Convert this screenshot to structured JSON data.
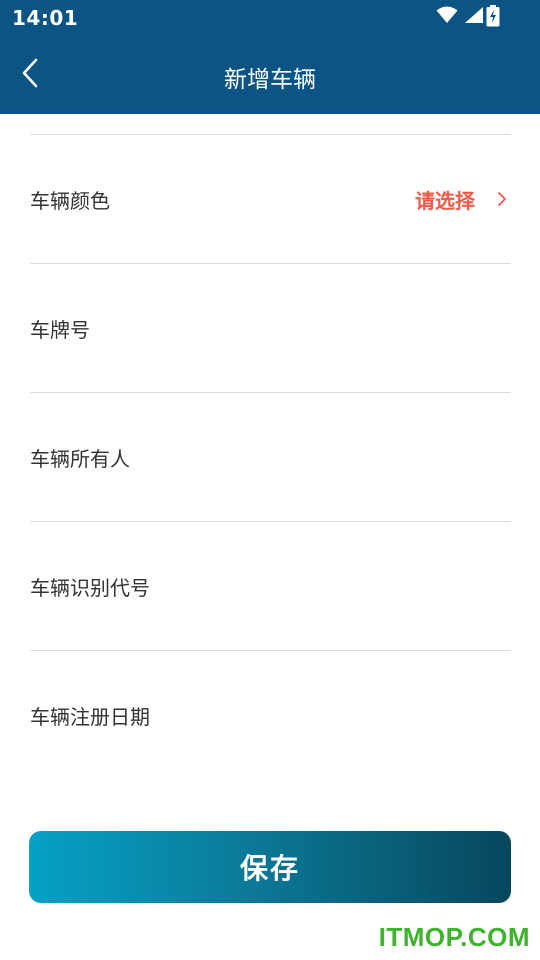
{
  "status_bar": {
    "time": "14:01",
    "icons": [
      "wifi-icon",
      "signal-icon",
      "battery-charging-icon"
    ]
  },
  "nav": {
    "back_icon": "chevron-left-icon",
    "title": "新增车辆"
  },
  "form": {
    "rows": [
      {
        "label": "车辆颜色",
        "value": "请选择",
        "has_chevron": true
      },
      {
        "label": "车牌号"
      },
      {
        "label": "车辆所有人"
      },
      {
        "label": "车辆识别代号"
      },
      {
        "label": "车辆注册日期"
      }
    ]
  },
  "save_button": {
    "label": "保存"
  },
  "watermark": {
    "text": "ITMOP.COM"
  },
  "colors": {
    "header_bg": "#0b5483",
    "accent_red": "#f25a47",
    "button_gradient_start": "#06a1c5",
    "button_gradient_end": "#07475c",
    "watermark_green": "#3db42b"
  }
}
